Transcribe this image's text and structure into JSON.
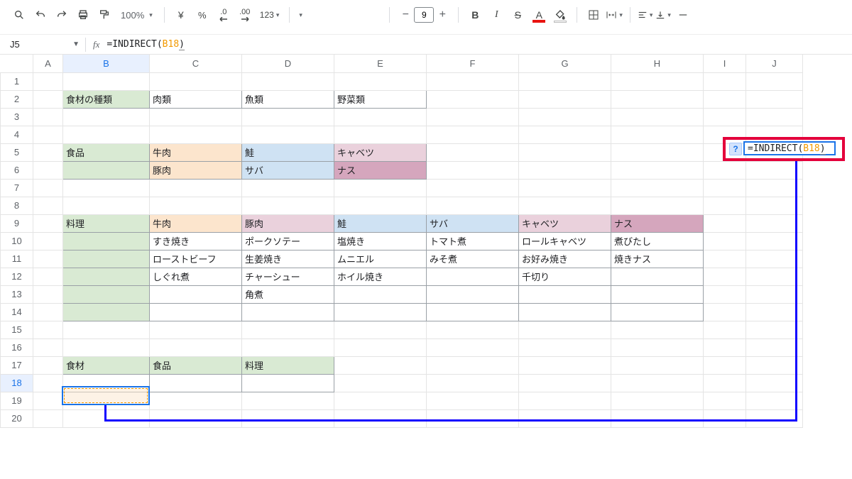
{
  "toolbar": {
    "zoom": "100%",
    "currency": "¥",
    "percent": "%",
    "dec_dec": ".0",
    "dec_inc": ".00",
    "num_fmt": "123",
    "font_size": "9"
  },
  "name_box": "J5",
  "formula_bar": {
    "eq": "=",
    "fn_open": "INDIRECT(",
    "ref": "B18",
    "close": ")"
  },
  "columns": [
    "",
    "A",
    "B",
    "C",
    "D",
    "E",
    "F",
    "G",
    "H",
    "I",
    "J"
  ],
  "rows": [
    "1",
    "2",
    "3",
    "4",
    "5",
    "6",
    "7",
    "8",
    "9",
    "10",
    "11",
    "12",
    "13",
    "14",
    "15",
    "16",
    "17",
    "18",
    "19",
    "20"
  ],
  "cells": {
    "B2": "食材の種類",
    "C2": "肉類",
    "D2": "魚類",
    "E2": "野菜類",
    "B5": "食品",
    "C5": "牛肉",
    "D5": "鮭",
    "E5": "キャベツ",
    "C6": "豚肉",
    "D6": "サバ",
    "E6": "ナス",
    "B9": "料理",
    "C9": "牛肉",
    "D9": "豚肉",
    "E9": "鮭",
    "F9": "サバ",
    "G9": "キャベツ",
    "H9": "ナス",
    "C10": "すき焼き",
    "D10": "ポークソテー",
    "E10": "塩焼き",
    "F10": "トマト煮",
    "G10": "ロールキャベツ",
    "H10": "煮びたし",
    "C11": "ローストビーフ",
    "D11": "生姜焼き",
    "E11": "ムニエル",
    "F11": "みそ煮",
    "G11": "お好み焼き",
    "H11": "焼きナス",
    "C12": "しぐれ煮",
    "D12": "チャーシュー",
    "E12": "ホイル焼き",
    "G12": "千切り",
    "D13": "角煮",
    "B17": "食材",
    "C17": "食品",
    "D17": "料理"
  },
  "j5_overlay": {
    "eq": "=",
    "fn_open": "INDIRECT(",
    "ref": "B18",
    "close": ")",
    "help": "?"
  }
}
